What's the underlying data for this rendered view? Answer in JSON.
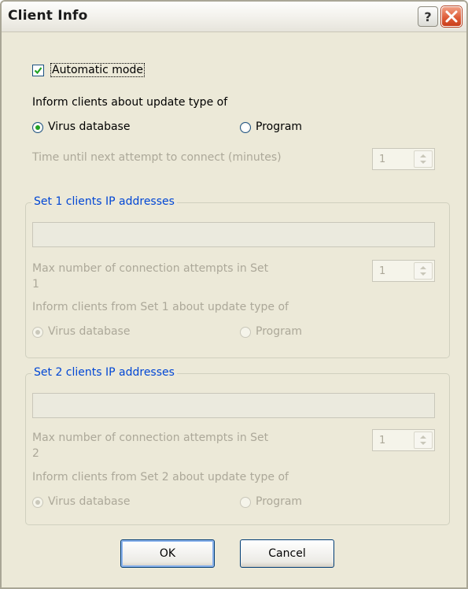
{
  "window": {
    "title": "Client Info"
  },
  "automatic_mode": {
    "label": "Automatic mode",
    "checked": true
  },
  "inform_label": "Inform clients about update type of",
  "update_type": {
    "options": [
      "Virus database",
      "Program"
    ],
    "selected": "Virus database"
  },
  "retry_time": {
    "label": "Time until next attempt to connect (minutes)",
    "value": "1"
  },
  "sets": [
    {
      "legend": "Set 1 clients IP addresses",
      "ip_value": "",
      "max_attempts_label_line1": "Max number of connection attempts in Set",
      "max_attempts_label_line2": "1",
      "max_attempts_value": "1",
      "inform_label": "Inform clients from Set 1 about update type of",
      "options": [
        "Virus database",
        "Program"
      ],
      "selected": "Virus database"
    },
    {
      "legend": "Set 2 clients IP addresses",
      "ip_value": "",
      "max_attempts_label_line1": "Max number of connection attempts in Set",
      "max_attempts_label_line2": "2",
      "max_attempts_value": "1",
      "inform_label": "Inform clients from Set 2 about update type of",
      "options": [
        "Virus database",
        "Program"
      ],
      "selected": "Virus database"
    }
  ],
  "buttons": {
    "ok": "OK",
    "cancel": "Cancel"
  },
  "icons": {
    "help": "help-icon",
    "close": "close-icon",
    "check": "checkmark-icon"
  },
  "colors": {
    "group_legend": "#0046d5",
    "check_mark": "#21a121",
    "close_button": "#de5e3a"
  }
}
